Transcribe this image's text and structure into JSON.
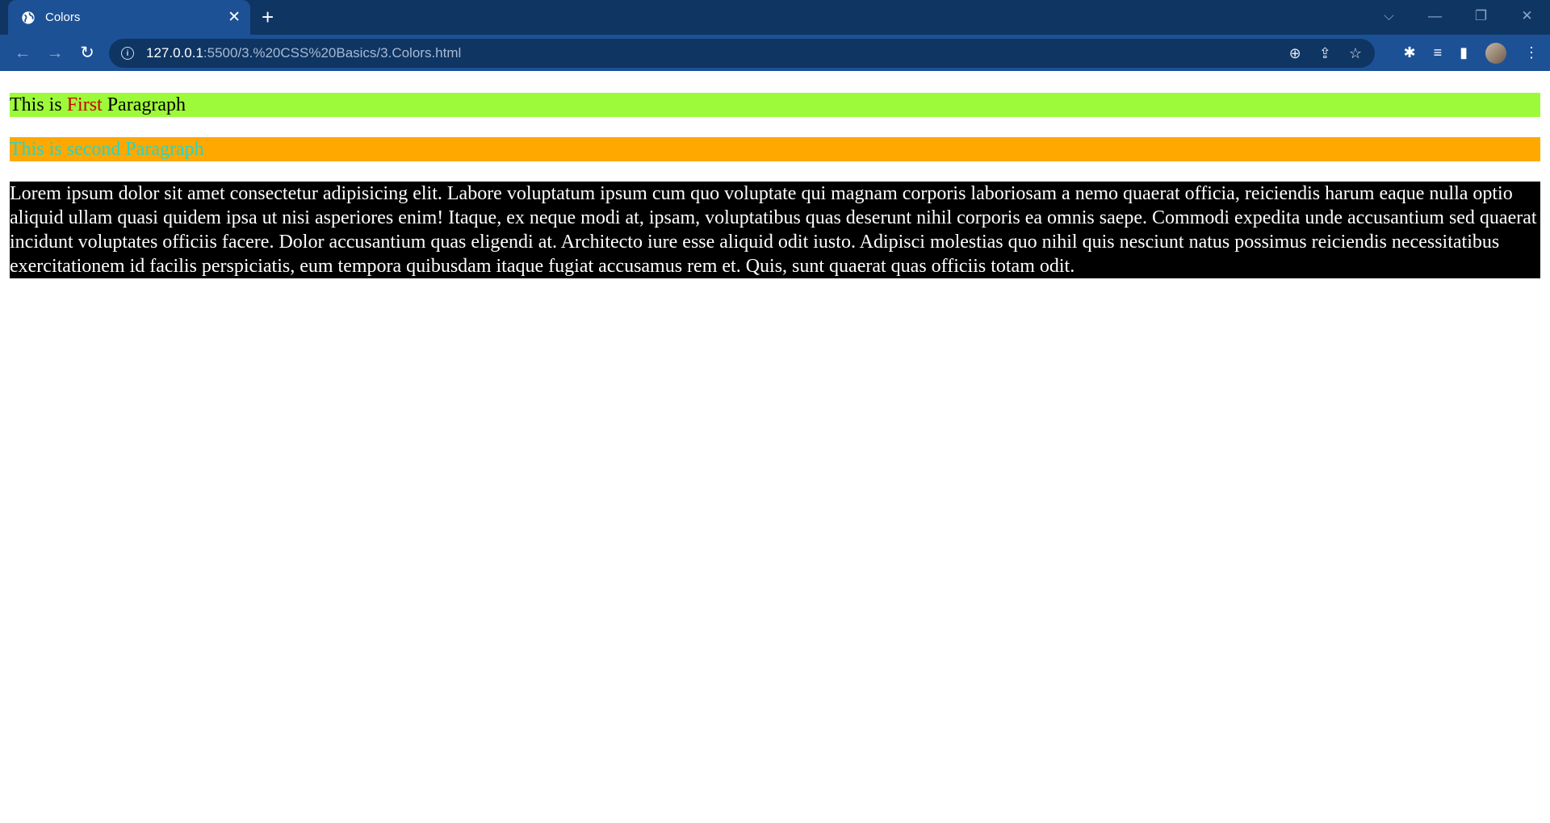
{
  "tab": {
    "title": "Colors",
    "close_glyph": "✕",
    "favicon": "globe-icon"
  },
  "new_tab_glyph": "+",
  "window_controls": {
    "tab_search": "⌵",
    "minimize": "—",
    "restore": "❐",
    "close": "✕"
  },
  "toolbar": {
    "back": "←",
    "forward": "→",
    "reload": "↻",
    "url_host": "127.0.0.1",
    "url_rest": ":5500/3.%20CSS%20Basics/3.Colors.html",
    "zoom": "⊕",
    "share": "⇪",
    "bookmark": "☆",
    "extensions": "✱",
    "media": "≡",
    "sidepanel": "▮",
    "menu": "⋮"
  },
  "page": {
    "p1_before": "This is ",
    "p1_highlight": "First",
    "p1_after": " Paragraph",
    "p2": "This is second Paragraph",
    "p3": "Lorem ipsum dolor sit amet consectetur adipisicing elit. Labore voluptatum ipsum cum quo voluptate qui magnam corporis laboriosam a nemo quaerat officia, reiciendis harum eaque nulla optio aliquid ullam quasi quidem ipsa ut nisi asperiores enim! Itaque, ex neque modi at, ipsam, voluptatibus quas deserunt nihil corporis ea omnis saepe. Commodi expedita unde accusantium sed quaerat incidunt voluptates officiis facere. Dolor accusantium quas eligendi at. Architecto iure esse aliquid odit iusto. Adipisci molestias quo nihil quis nesciunt natus possimus reiciendis necessitatibus exercitationem id facilis perspiciatis, eum tempora quibusdam itaque fugiat accusamus rem et. Quis, sunt quaerat quas officiis totam odit."
  },
  "colors": {
    "p1_bg": "#9dfa3a",
    "p1_highlight": "#cc0000",
    "p2_bg": "#ffa800",
    "p2_text": "#2ed3be",
    "p3_bg": "#000000",
    "p3_text": "#ffffff"
  }
}
